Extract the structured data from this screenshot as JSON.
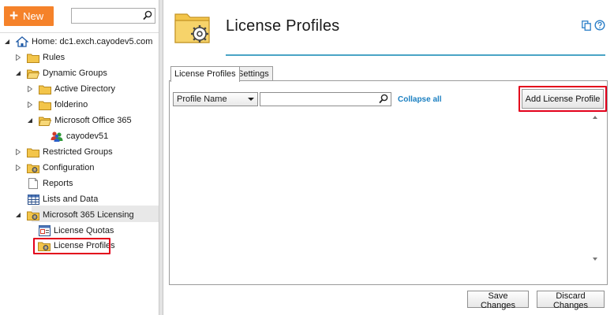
{
  "toolbar": {
    "new_label": "New",
    "search_value": "",
    "search_placeholder": ""
  },
  "tree": {
    "home": "Home: dc1.exch.cayodev5.com",
    "rules": "Rules",
    "dynamic_groups": "Dynamic Groups",
    "active_directory": "Active Directory",
    "folderino": "folderino",
    "microsoft_office_365": "Microsoft Office 365",
    "cayodev51": "cayodev51",
    "restricted_groups": "Restricted Groups",
    "configuration": "Configuration",
    "reports": "Reports",
    "lists_and_data": "Lists and Data",
    "m365_licensing": "Microsoft 365 Licensing",
    "license_quotas": "License Quotas",
    "license_profiles": "License Profiles"
  },
  "main": {
    "title": "License Profiles",
    "tabs": [
      "License Profiles",
      "Settings"
    ],
    "filter": {
      "field_selected": "Profile Name",
      "search_value": "",
      "collapse_all": "Collapse all"
    },
    "add_button": "Add License Profile",
    "footer": {
      "save": "Save Changes",
      "discard": "Discard Changes"
    }
  },
  "colors": {
    "accent_orange": "#f5822a",
    "header_line": "#4aa4c5",
    "highlight_red": "#e3001b",
    "link_blue": "#1a7fc1",
    "folder_yellow": "#f3c54a"
  },
  "icons": {
    "new": "plus-icon",
    "search": "search-icon",
    "home": "home-icon",
    "folder": "folder-icon",
    "config_folder": "config-folder-icon",
    "report": "report-icon",
    "list": "list-icon",
    "users": "users-icon",
    "quota": "quota-icon",
    "copy": "copy-icon",
    "help": "help-icon"
  }
}
